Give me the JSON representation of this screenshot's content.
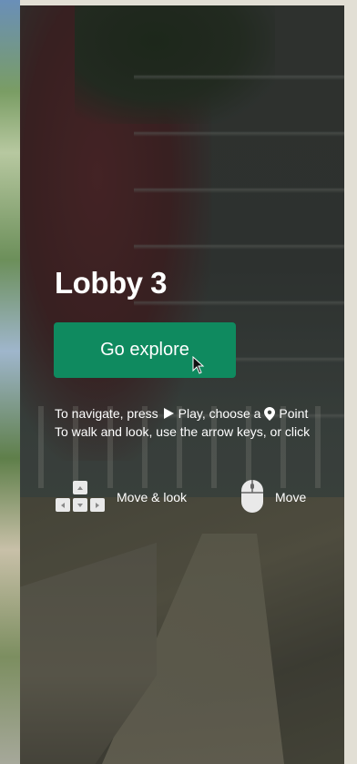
{
  "tour": {
    "title": "Lobby 3",
    "explore_label": "Go explore"
  },
  "instructions": {
    "line1_prefix": "To navigate, press",
    "line1_play": "Play, choose a",
    "line1_point": "Point",
    "line2": "To walk and look, use the arrow keys, or click"
  },
  "controls": {
    "keys_label": "Move & look",
    "mouse_label": "Move"
  },
  "icons": {
    "play": "play-icon",
    "point": "location-pin-icon",
    "keys": "arrow-keys-icon",
    "mouse": "mouse-icon",
    "cursor": "cursor-icon"
  },
  "colors": {
    "accent": "#0f8a5f",
    "text": "#ffffff"
  }
}
